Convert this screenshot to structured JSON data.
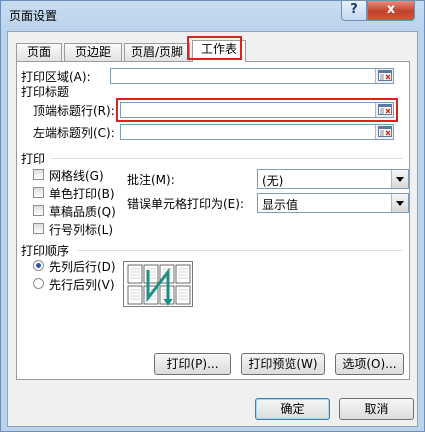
{
  "window": {
    "title": "页面设置",
    "help_label": "?",
    "close_label": "x"
  },
  "tabs": [
    {
      "label": "页面"
    },
    {
      "label": "页边距"
    },
    {
      "label": "页眉/页脚"
    },
    {
      "label": "工作表"
    }
  ],
  "print_area": {
    "label": "打印区域(A):",
    "value": ""
  },
  "print_titles": {
    "group_label": "打印标题",
    "rows_label": "顶端标题行(R):",
    "rows_value": "",
    "cols_label": "左端标题列(C):",
    "cols_value": ""
  },
  "print": {
    "group_label": "打印",
    "options": [
      {
        "label": "网格线(G)",
        "checked": false
      },
      {
        "label": "单色打印(B)",
        "checked": false
      },
      {
        "label": "草稿品质(Q)",
        "checked": false
      },
      {
        "label": "行号列标(L)",
        "checked": false
      }
    ],
    "comments_label": "批注(M):",
    "comments_value": "(无)",
    "errors_label": "错误单元格打印为(E):",
    "errors_value": "显示值"
  },
  "page_order": {
    "group_label": "打印顺序",
    "options": [
      {
        "label": "先列后行(D)",
        "selected": true
      },
      {
        "label": "先行后列(V)",
        "selected": false
      }
    ]
  },
  "buttons": {
    "print": "打印(P)...",
    "preview": "打印预览(W)",
    "options": "选项(O)...",
    "ok": "确定",
    "cancel": "取消"
  },
  "colors": {
    "highlight": "#d9231e",
    "accent": "#3c7fb1"
  }
}
